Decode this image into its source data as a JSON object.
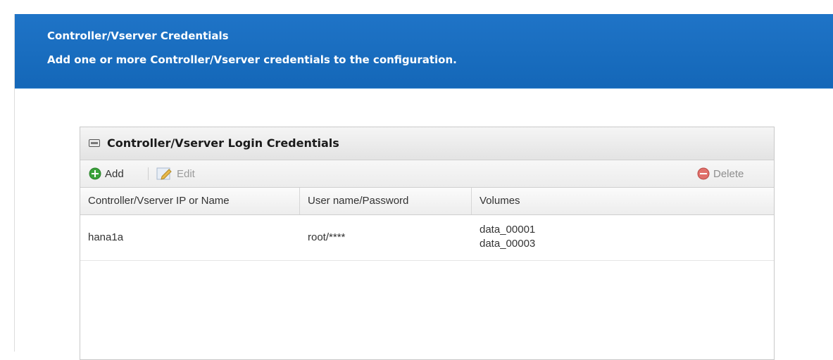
{
  "banner": {
    "title": "Controller/Vserver Credentials",
    "subtitle": "Add one or more Controller/Vserver credentials to the configuration."
  },
  "panel": {
    "title": "Controller/Vserver Login Credentials",
    "icon": "keyboard-icon"
  },
  "toolbar": {
    "add_label": "Add",
    "edit_label": "Edit",
    "delete_label": "Delete"
  },
  "table": {
    "columns": [
      "Controller/Vserver IP or Name",
      "User name/Password",
      "Volumes"
    ],
    "rows": [
      {
        "name": "hana1a",
        "credentials": "root/****",
        "volumes": [
          "data_00001",
          "data_00003"
        ]
      }
    ]
  },
  "colors": {
    "banner": "#1467b8",
    "add_icon": "#3aa23a",
    "delete_icon": "#d9534f"
  }
}
